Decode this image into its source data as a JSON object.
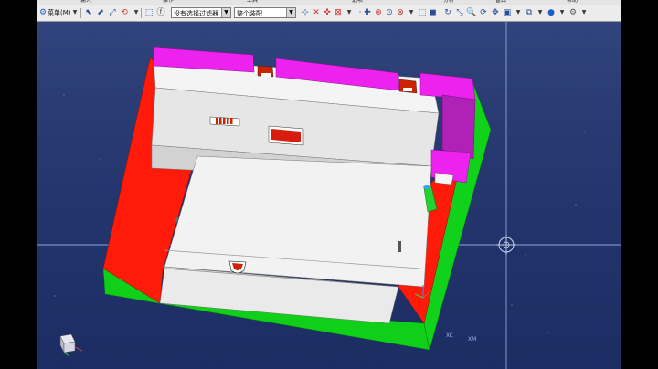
{
  "menu_labels": [
    "输入",
    "操作",
    "工具",
    "选项",
    "分析",
    "窗口",
    "帮助"
  ],
  "toolbar": {
    "menu_label": "菜单(M)",
    "selection_filter": "没有选择过滤器",
    "assembly_scope": "整个装配"
  },
  "viewport": {
    "triad_labels": [
      "XC",
      "XM"
    ],
    "crosshair_icon": "crosshair-icon",
    "orient_icon": "view-orientation-icon"
  },
  "colors": {
    "background_top": "#33467f",
    "background_bottom": "#1b2d63",
    "face_red": "#ff1a0a",
    "face_green": "#11d21a",
    "face_magenta": "#ee22ee",
    "face_white": "#ededed"
  }
}
